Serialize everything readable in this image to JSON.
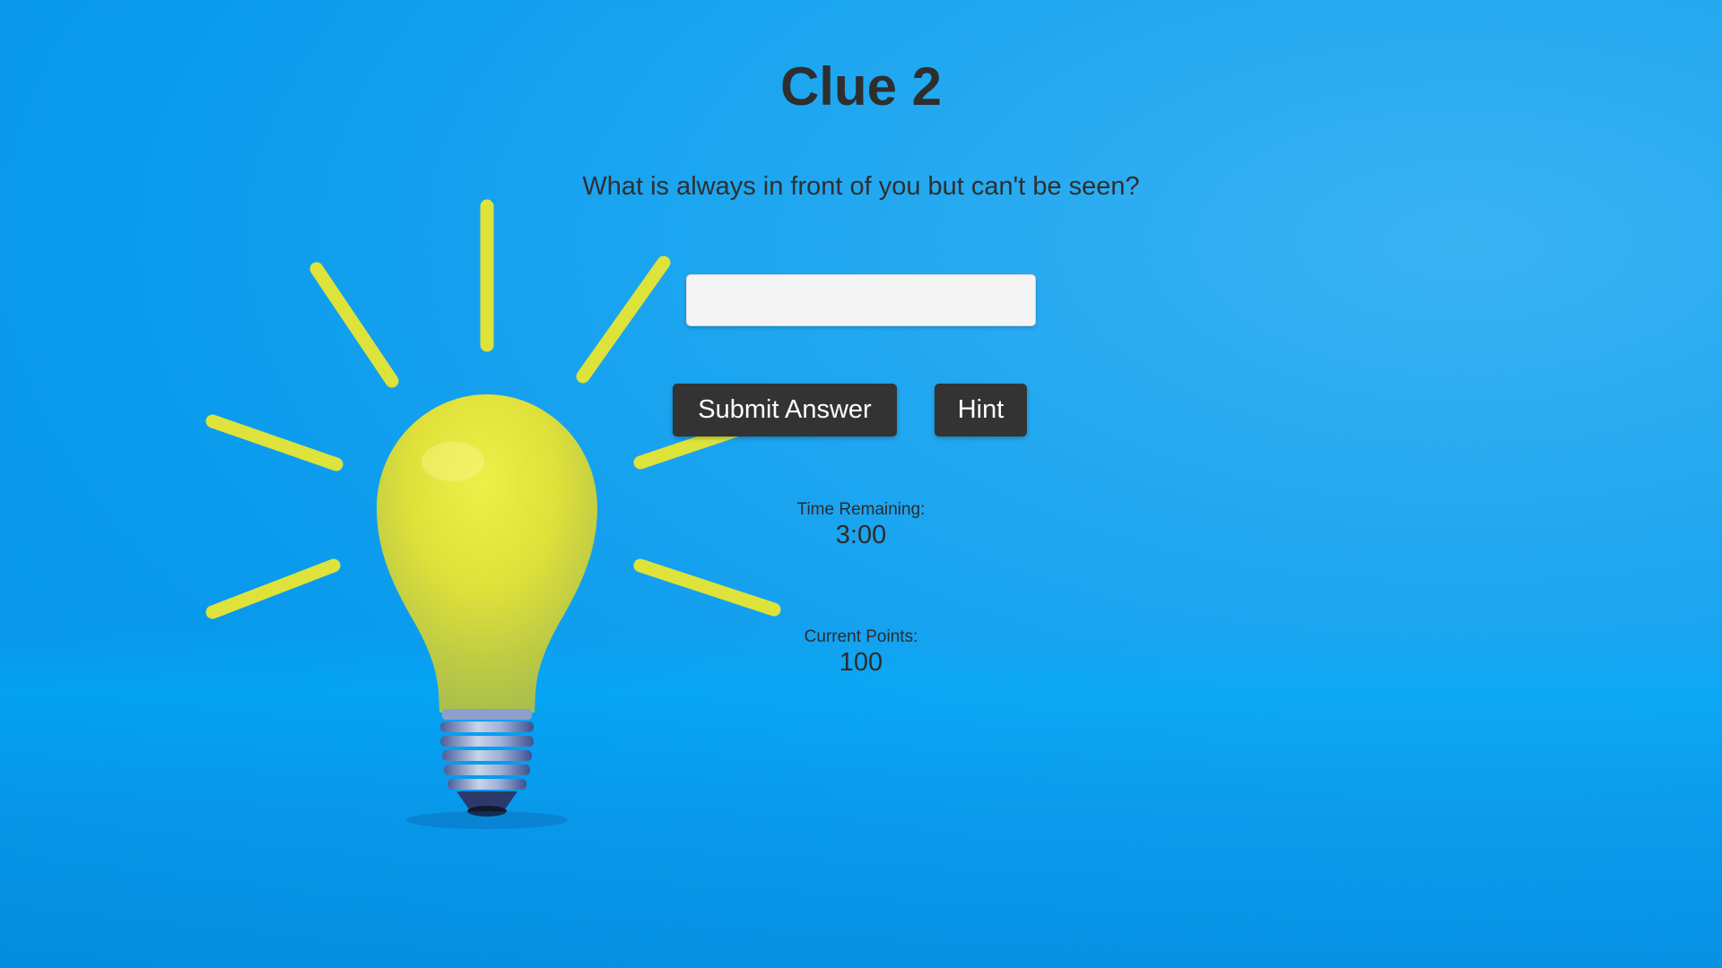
{
  "page": {
    "title": "Clue 2",
    "question": "What is always in front of you but can't be seen?"
  },
  "answer": {
    "value": "",
    "placeholder": ""
  },
  "buttons": {
    "submit_label": "Submit Answer",
    "hint_label": "Hint"
  },
  "stats": {
    "time_label": "Time Remaining:",
    "time_value": "3:00",
    "points_label": "Current Points:",
    "points_value": "100"
  },
  "colors": {
    "background": "#0a9bee",
    "title_text": "#2e2e2e",
    "button_bg": "#333333",
    "button_text": "#ffffff",
    "input_bg": "#f4f4f4",
    "bulb": "#e4e232",
    "rays": "#dde33a"
  },
  "icons": {
    "background_art": "lightbulb-icon"
  }
}
